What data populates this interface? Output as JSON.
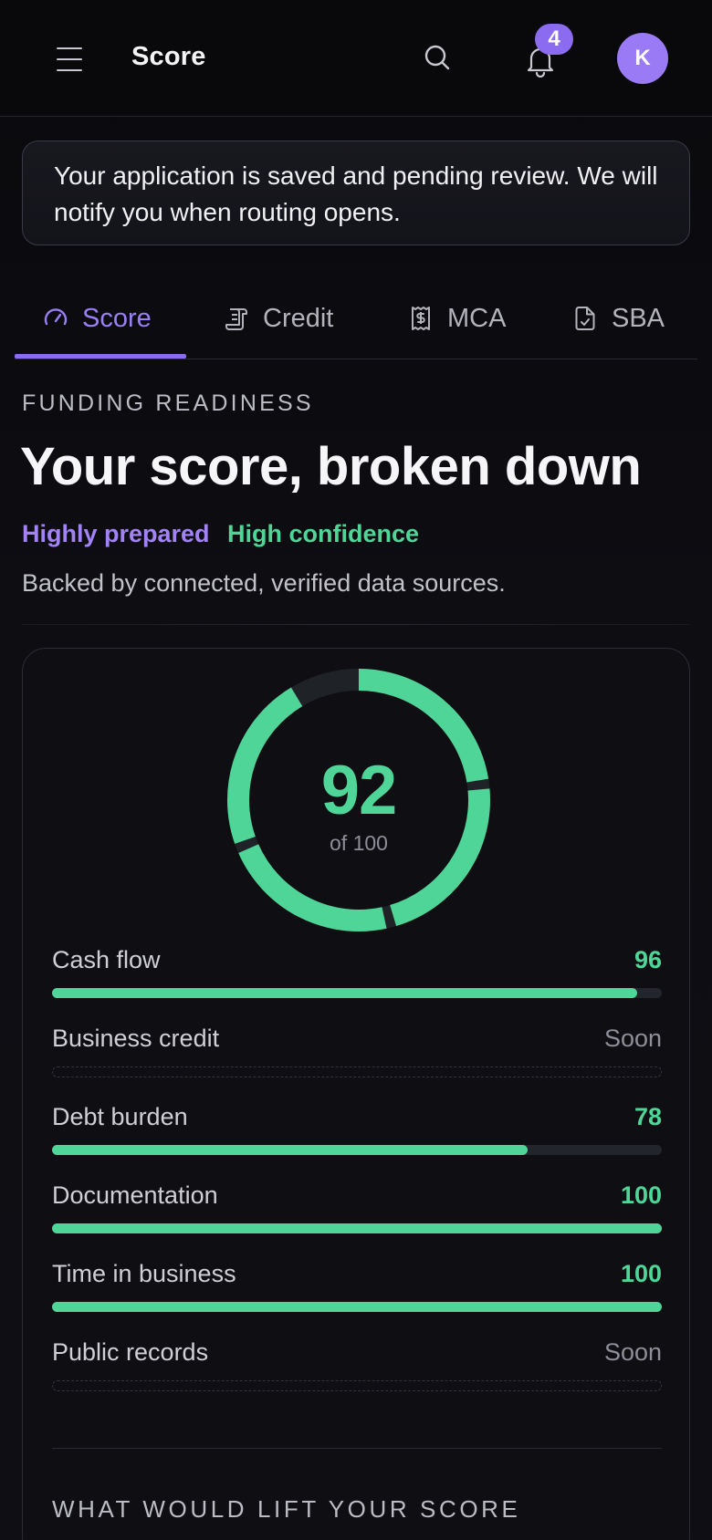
{
  "header": {
    "title": "Score",
    "notification_count": "4",
    "avatar_initial": "K"
  },
  "notice": {
    "text": "Your application is saved and pending review. We will notify you when routing opens."
  },
  "tabs": [
    {
      "label": "Score",
      "icon": "gauge-icon",
      "active": true
    },
    {
      "label": "Credit",
      "icon": "scroll-icon",
      "active": false
    },
    {
      "label": "MCA",
      "icon": "receipt-dollar-icon",
      "active": false
    },
    {
      "label": "SBA",
      "icon": "file-check-icon",
      "active": false
    }
  ],
  "readiness": {
    "eyebrow": "FUNDING READINESS",
    "heading": "Your score, broken down",
    "preparedness": "Highly prepared",
    "confidence": "High confidence",
    "subtext": "Backed by connected, verified data sources."
  },
  "score": {
    "value": 92,
    "value_label": "92",
    "max_label": "of 100",
    "gauge_color": "#4fd597"
  },
  "metrics": [
    {
      "label": "Cash flow",
      "value": 96,
      "display": "96",
      "available": true
    },
    {
      "label": "Business credit",
      "value": null,
      "display": "Soon",
      "available": false
    },
    {
      "label": "Debt burden",
      "value": 78,
      "display": "78",
      "available": true
    },
    {
      "label": "Documentation",
      "value": 100,
      "display": "100",
      "available": true
    },
    {
      "label": "Time in business",
      "value": 100,
      "display": "100",
      "available": true
    },
    {
      "label": "Public records",
      "value": null,
      "display": "Soon",
      "available": false
    }
  ],
  "lift_section": {
    "title": "WHAT WOULD LIFT YOUR SCORE"
  },
  "colors": {
    "accent": "#8b6cf0",
    "success": "#4fd597",
    "background": "#0b0b10"
  }
}
